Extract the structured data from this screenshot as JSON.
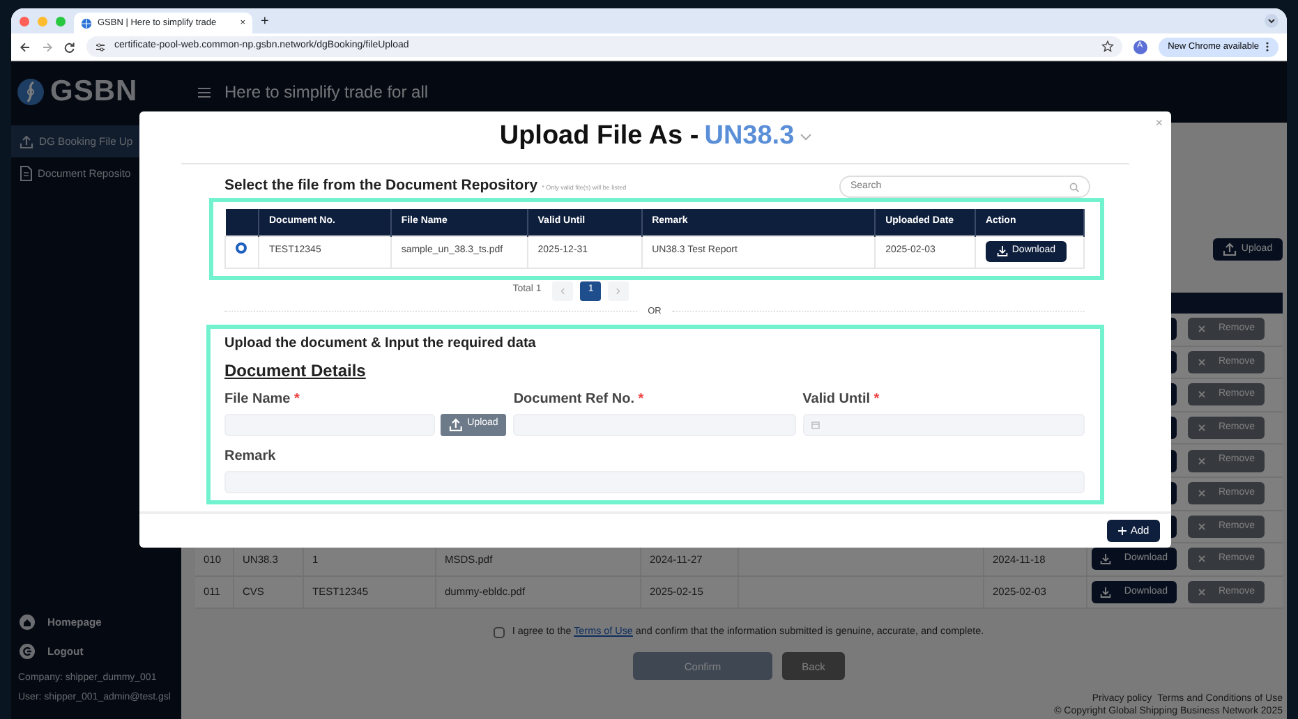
{
  "browser": {
    "tab_title": "GSBN | Here to simplify trade",
    "tab_close": "×",
    "new_tab": "+",
    "url": "certificate-pool-web.common-np.gsbn.network/dgBooking/fileUpload",
    "profile": "A",
    "update_button": "New Chrome available"
  },
  "header": {
    "logo": "GSBN",
    "tagline": "Here to simplify trade for all"
  },
  "sidebar": {
    "items": [
      {
        "label": "DG Booking File Up",
        "selected": true,
        "kind": "upload"
      },
      {
        "label": "Document Reposito",
        "selected": false,
        "kind": "document"
      }
    ],
    "bottom_items": [
      {
        "label": "Homepage",
        "kind": "home"
      },
      {
        "label": "Logout",
        "kind": "logout"
      }
    ],
    "company_label": "Company:",
    "company": "shipper_dummy_001",
    "user_label": "User:",
    "user": "shipper_001_admin@test.gsl"
  },
  "main": {
    "upload_button": "Upload",
    "rows": [
      {
        "remove": "Remove",
        "remove_disabled": true
      },
      {
        "remove": "Remove",
        "remove_disabled": true
      },
      {
        "remove": "Remove",
        "remove_disabled": true
      },
      {
        "remove": "Remove",
        "remove_disabled": true
      },
      {
        "remove": "Remove",
        "remove_disabled": true
      },
      {
        "remove": "Remove",
        "remove_disabled": true
      },
      {
        "remove": "Remove",
        "remove_disabled": true
      },
      {
        "no": "010",
        "type": "UN38.3",
        "doc_no": "1",
        "file": "MSDS.pdf",
        "valid": "2024-11-27",
        "uploaded": "2024-11-18",
        "download": "Download",
        "remove": "Remove",
        "remove_disabled": true
      },
      {
        "no": "011",
        "type": "CVS",
        "doc_no": "TEST12345",
        "file": "dummy-ebldc.pdf",
        "valid": "2025-02-15",
        "uploaded": "2025-02-03",
        "download": "Download",
        "remove": "Remove",
        "remove_disabled": true
      }
    ],
    "agreement": {
      "checked": false,
      "before": "I agree to the",
      "link": "Terms of Use",
      "after": "and confirm that the information submitted is genuine, accurate, and complete."
    },
    "confirm_button": "Confirm",
    "back_button": "Back",
    "footer_links": [
      "Privacy policy",
      "Terms and Conditions of Use"
    ],
    "copyright": "© Copyright Global Shipping Business Network 2025"
  },
  "modal": {
    "title": "Upload File As -",
    "doc_type": "UN38.3",
    "close": "×",
    "repository": {
      "heading": "Select the file from the Document Repository",
      "note": "* Only valid file(s) will be listed",
      "search_placeholder": "Search",
      "columns": [
        "Document No.",
        "File Name",
        "Valid Until",
        "Remark",
        "Uploaded Date",
        "Action"
      ],
      "rows": [
        {
          "selected": true,
          "doc_no": "TEST12345",
          "file": "sample_un_38.3_ts.pdf",
          "valid": "2025-12-31",
          "remark": "UN38.3 Test Report",
          "uploaded": "2025-02-03",
          "action": "Download"
        }
      ],
      "total": "Total 1",
      "pages": [
        {
          "label": "1",
          "selected": true
        }
      ]
    },
    "separator": "OR",
    "upload": {
      "heading": "Upload the document & Input the required data",
      "section": "Document Details",
      "fields": [
        {
          "kind": "file",
          "label": "File Name",
          "required_mark": "*",
          "button": "Upload"
        },
        {
          "kind": "text",
          "label": "Document Ref No.",
          "required_mark": "*"
        },
        {
          "kind": "date",
          "label": "Valid Until",
          "required_mark": "*"
        },
        {
          "kind": "wide",
          "label": "Remark"
        }
      ]
    },
    "add_button": "Add"
  }
}
